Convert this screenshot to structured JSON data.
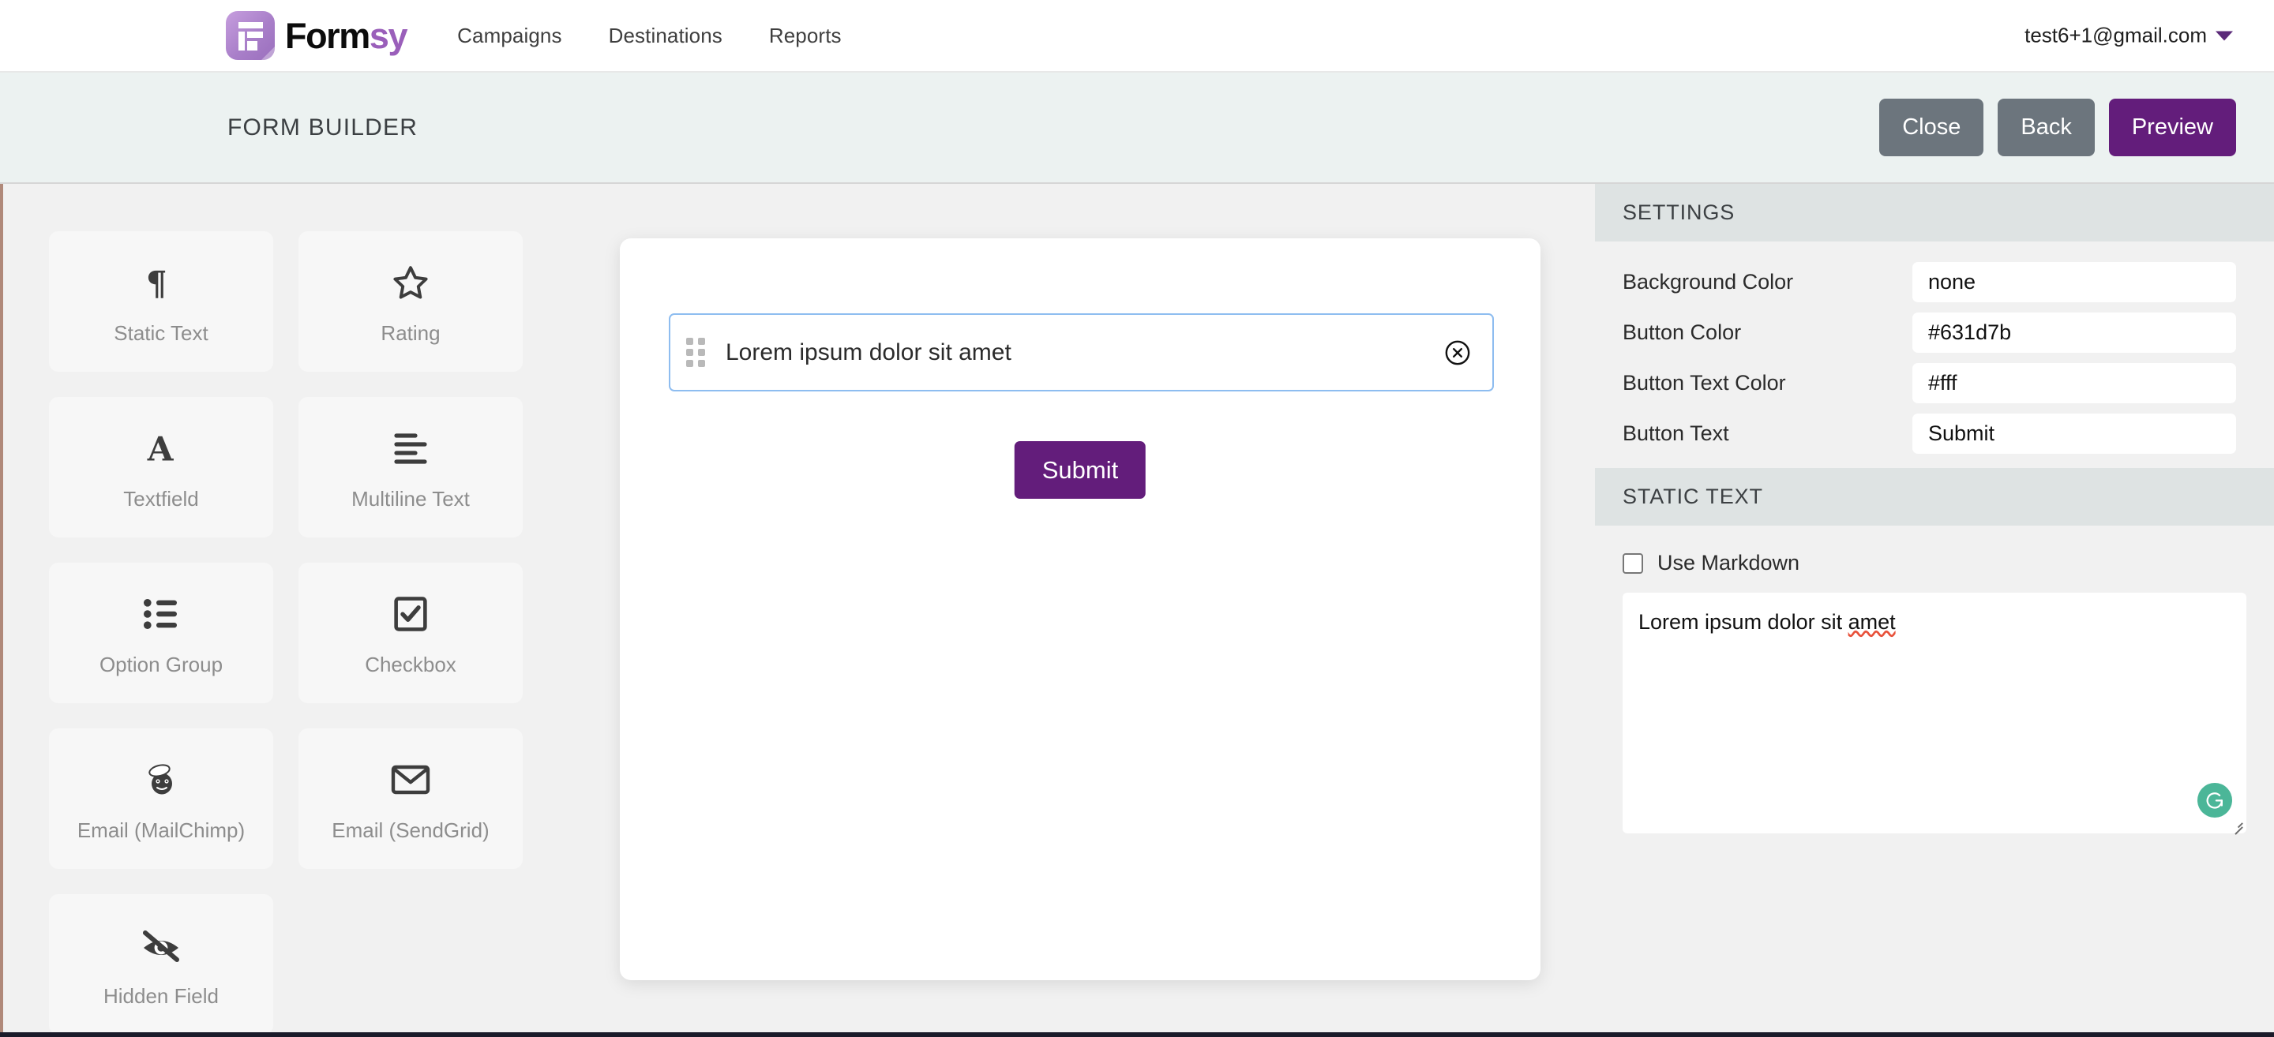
{
  "navbar": {
    "brand": {
      "word_dark": "Form",
      "word_accent": "sy",
      "logo_icon": "formsy-logo-icon"
    },
    "links": [
      {
        "label": "Campaigns"
      },
      {
        "label": "Destinations"
      },
      {
        "label": "Reports"
      }
    ],
    "user": {
      "email": "test6+1@gmail.com",
      "caret_icon": "chevron-down-icon"
    }
  },
  "toolbar": {
    "title": "FORM BUILDER",
    "close_label": "Close",
    "back_label": "Back",
    "preview_label": "Preview",
    "secondary_color": "#6c757d",
    "primary_color": "#631d7b"
  },
  "palette": {
    "items": [
      {
        "label": "Static Text",
        "icon": "paragraph-pilcrow-icon"
      },
      {
        "label": "Rating",
        "icon": "star-outline-icon"
      },
      {
        "label": "Textfield",
        "icon": "letter-a-icon"
      },
      {
        "label": "Multiline Text",
        "icon": "text-lines-icon"
      },
      {
        "label": "Option Group",
        "icon": "bullet-list-icon"
      },
      {
        "label": "Checkbox",
        "icon": "checkbox-checked-icon"
      },
      {
        "label": "Email (MailChimp)",
        "icon": "mailchimp-monkey-icon"
      },
      {
        "label": "Email (SendGrid)",
        "icon": "envelope-icon"
      },
      {
        "label": "Hidden Field",
        "icon": "eye-slash-icon"
      }
    ]
  },
  "canvas": {
    "field_text": "Lorem ipsum dolor sit amet",
    "drag_icon": "drag-handle-icon",
    "delete_icon": "circle-x-icon",
    "submit_label": "Submit",
    "submit_color": "#631d7b"
  },
  "settings": {
    "header": "SETTINGS",
    "rows": [
      {
        "label": "Background Color",
        "value": "none"
      },
      {
        "label": "Button Color",
        "value": "#631d7b"
      },
      {
        "label": "Button Text Color",
        "value": "#fff"
      },
      {
        "label": "Button Text",
        "value": "Submit"
      }
    ]
  },
  "static_text": {
    "header": "STATIC TEXT",
    "markdown_label": "Use Markdown",
    "markdown_checked": false,
    "textarea_value": "Lorem ipsum dolor sit amet",
    "textarea_plain": "Lorem ipsum dolor sit ",
    "textarea_misspelled": "amet",
    "grammarly_icon": "grammarly-badge-icon",
    "grammarly_color": "#4bb698",
    "resize_icon": "resize-grip-icon"
  }
}
